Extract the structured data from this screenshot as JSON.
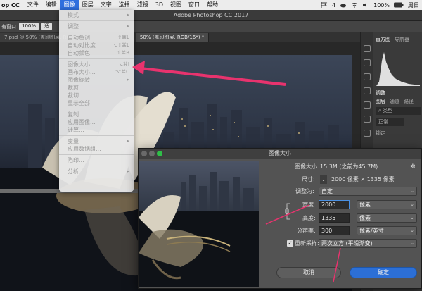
{
  "menubar": {
    "app": "op CC",
    "items": [
      "文件",
      "编辑",
      "图像",
      "图层",
      "文字",
      "选择",
      "滤镜",
      "3D",
      "视图",
      "窗口",
      "帮助"
    ],
    "active_index": 2,
    "right": {
      "badge": "4",
      "battery": "100%",
      "clock": "周日"
    }
  },
  "app_title": "Adobe Photoshop CC 2017",
  "options_bar": {
    "label1": "有窗口",
    "zoom": "100%",
    "label2": "适"
  },
  "doc_tabs": {
    "tab1": "7.psd @ 50% (盖印图层, RG",
    "tab2": "50% (盖印图层, RGB/16*) *"
  },
  "image_menu": {
    "items": [
      {
        "label": "模式",
        "shortcut": "▸",
        "enabled": false
      },
      {
        "sep": true
      },
      {
        "label": "调整",
        "shortcut": "▸",
        "enabled": false
      },
      {
        "sep": true
      },
      {
        "label": "自动色调",
        "shortcut": "⇧⌘L",
        "enabled": false
      },
      {
        "label": "自动对比度",
        "shortcut": "⌥⇧⌘L",
        "enabled": false
      },
      {
        "label": "自动颜色",
        "shortcut": "⇧⌘B",
        "enabled": false
      },
      {
        "sep": true
      },
      {
        "label": "图像大小...",
        "shortcut": "⌥⌘I",
        "enabled": false
      },
      {
        "label": "画布大小...",
        "shortcut": "⌥⌘C",
        "enabled": false
      },
      {
        "label": "图像旋转",
        "shortcut": "▸",
        "enabled": false
      },
      {
        "label": "裁剪",
        "shortcut": "",
        "enabled": false
      },
      {
        "label": "裁切...",
        "shortcut": "",
        "enabled": false
      },
      {
        "label": "显示全部",
        "shortcut": "",
        "enabled": false
      },
      {
        "sep": true
      },
      {
        "label": "复制...",
        "shortcut": "",
        "enabled": false
      },
      {
        "label": "应用图像...",
        "shortcut": "",
        "enabled": false
      },
      {
        "label": "计算...",
        "shortcut": "",
        "enabled": false
      },
      {
        "sep": true
      },
      {
        "label": "变量",
        "shortcut": "▸",
        "enabled": false
      },
      {
        "label": "应用数据组...",
        "shortcut": "",
        "enabled": false
      },
      {
        "sep": true
      },
      {
        "label": "陷印...",
        "shortcut": "",
        "enabled": false
      },
      {
        "sep": true
      },
      {
        "label": "分析",
        "shortcut": "▸",
        "enabled": false
      }
    ]
  },
  "right_panel": {
    "tabs1": [
      "直方图",
      "导航器"
    ],
    "tabs2": [
      "调整"
    ],
    "tabs3": [
      "图层",
      "通道",
      "路径"
    ],
    "search": "类型",
    "mode": "正常",
    "lock": "锁定"
  },
  "dialog": {
    "title": "图像大小",
    "size_label": "图像大小:",
    "size_value": "15.3M (之前为45.7M)",
    "dim_label": "尺寸:",
    "dim_value": "2000 像素 × 1335 像素",
    "fit_label": "调整为:",
    "fit_value": "自定",
    "width_label": "宽度:",
    "width_value": "2000",
    "width_unit": "像素",
    "height_label": "高度:",
    "height_value": "1335",
    "height_unit": "像素",
    "res_label": "分辨率:",
    "res_value": "300",
    "res_unit": "像素/英寸",
    "resample_label": "重新采样:",
    "resample_value": "两次立方 (平滑渐变)",
    "cancel": "取消",
    "ok": "确定"
  },
  "colors": {
    "accent": "#2f6fde",
    "arrow": "#e8336e",
    "ok_button": "#2c6fd6"
  }
}
